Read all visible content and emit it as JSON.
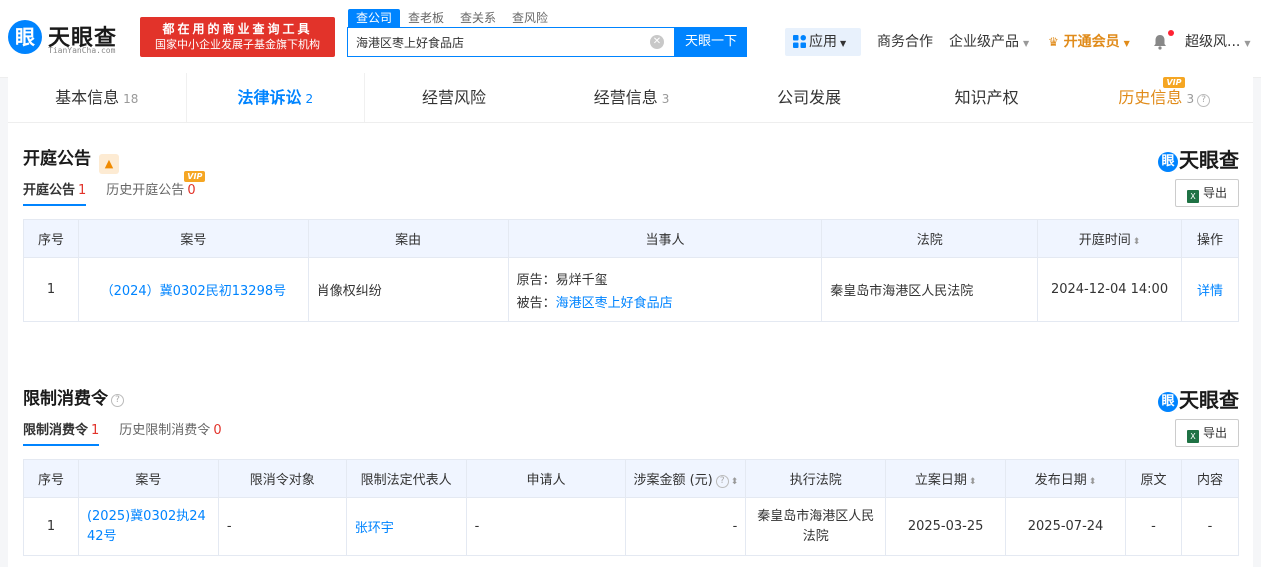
{
  "header": {
    "logo_text": "天眼查",
    "logo_sub": "TianYanCha.com",
    "slogan_line1": "都在用的商业查询工具",
    "slogan_line2": "国家中小企业发展子基金旗下机构",
    "search_tabs": [
      "查公司",
      "查老板",
      "查关系",
      "查风险"
    ],
    "search_value": "海港区枣上好食品店",
    "search_button": "天眼一下",
    "nav_apps": "应用",
    "nav_business": "商务合作",
    "nav_enterprise": "企业级产品",
    "nav_vip": "开通会员",
    "nav_user": "超级风..."
  },
  "tabs": [
    {
      "label": "基本信息",
      "count": "18"
    },
    {
      "label": "法律诉讼",
      "count": "2"
    },
    {
      "label": "经营风险",
      "count": ""
    },
    {
      "label": "经营信息",
      "count": "3"
    },
    {
      "label": "公司发展",
      "count": ""
    },
    {
      "label": "知识产权",
      "count": ""
    },
    {
      "label": "历史信息",
      "count": "3"
    }
  ],
  "vip_badge": "VIP",
  "watermark": "天眼查",
  "export_label": "导出",
  "court": {
    "title": "开庭公告",
    "subtabs": [
      {
        "label": "开庭公告",
        "count": "1"
      },
      {
        "label": "历史开庭公告",
        "count": "0"
      }
    ],
    "headers": [
      "序号",
      "案号",
      "案由",
      "当事人",
      "法院",
      "开庭时间",
      "操作"
    ],
    "rows": [
      {
        "no": "1",
        "case_no": "（2024）冀0302民初13298号",
        "cause": "肖像权纠纷",
        "plaintiff_label": "原告：",
        "plaintiff": "易烊千玺",
        "defendant_label": "被告：",
        "defendant": "海港区枣上好食品店",
        "court": "秦皇岛市海港区人民法院",
        "time": "2024-12-04 14:00",
        "action": "详情"
      }
    ]
  },
  "restrict": {
    "title": "限制消费令",
    "subtabs": [
      {
        "label": "限制消费令",
        "count": "1"
      },
      {
        "label": "历史限制消费令",
        "count": "0"
      }
    ],
    "headers": [
      "序号",
      "案号",
      "限消令对象",
      "限制法定代表人",
      "申请人",
      "涉案金额 (元)",
      "执行法院",
      "立案日期",
      "发布日期",
      "原文",
      "内容"
    ],
    "rows": [
      {
        "no": "1",
        "case_no": "(2025)冀0302执2442号",
        "target": "-",
        "rep": "张环宇",
        "applicant": "-",
        "amount": "-",
        "court": "秦皇岛市海港区人民法院",
        "file_date": "2025-03-25",
        "pub_date": "2025-07-24",
        "original": "-",
        "content": "-"
      }
    ]
  },
  "colors": {
    "accent": "#0084ff",
    "red": "#e2332a",
    "vip": "#e08b1a"
  }
}
